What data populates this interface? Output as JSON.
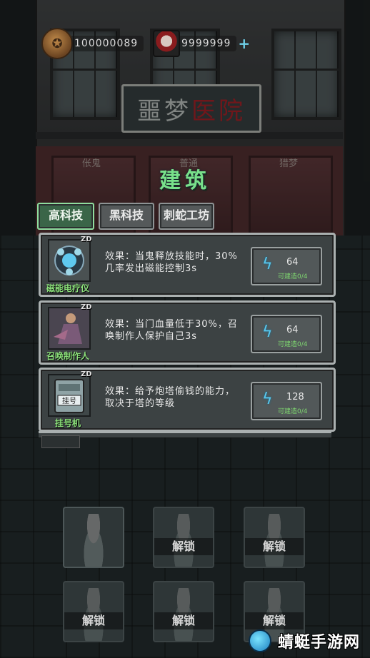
{
  "resources": {
    "coins": "100000089",
    "gems": "9999999"
  },
  "sign": {
    "part1": "噩梦",
    "part2": "医院"
  },
  "doors": [
    "伥鬼",
    "普通",
    "猎梦"
  ],
  "title": "建筑",
  "tabs": [
    {
      "label": "高科技",
      "active": true
    },
    {
      "label": "黑科技",
      "active": false
    },
    {
      "label": "刺蛇工坊",
      "active": false
    }
  ],
  "buildings": [
    {
      "name": "磁能电疗仪",
      "tag": "ZD",
      "effect": "效果：当鬼释放技能时，30%几率发出磁能控制3s",
      "cost": "64",
      "buildable": "可建造0/4",
      "icon": "magnetic-device-icon"
    },
    {
      "name": "召唤制作人",
      "tag": "ZD",
      "effect": "效果：当门血量低于30%，召唤制作人保护自己3s",
      "cost": "64",
      "buildable": "可建造0/4",
      "icon": "summon-producer-icon"
    },
    {
      "name": "挂号机",
      "tag": "ZD",
      "effect": "效果：给予炮塔偷钱的能力，取决于塔的等级",
      "cost": "128",
      "buildable": "可建造0/4",
      "icon": "registration-machine-icon",
      "machine_label": "挂号"
    }
  ],
  "character_slots": [
    {
      "locked": false,
      "label": ""
    },
    {
      "locked": true,
      "label": "解锁"
    },
    {
      "locked": true,
      "label": "解锁"
    },
    {
      "locked": true,
      "label": "解锁"
    },
    {
      "locked": true,
      "label": "解锁"
    },
    {
      "locked": true,
      "label": "解锁"
    }
  ],
  "watermark": "蜻蜓手游网",
  "colors": {
    "accent_green": "#78e08a",
    "bolt_blue": "#58c8ef",
    "name_green": "#8be07a"
  }
}
